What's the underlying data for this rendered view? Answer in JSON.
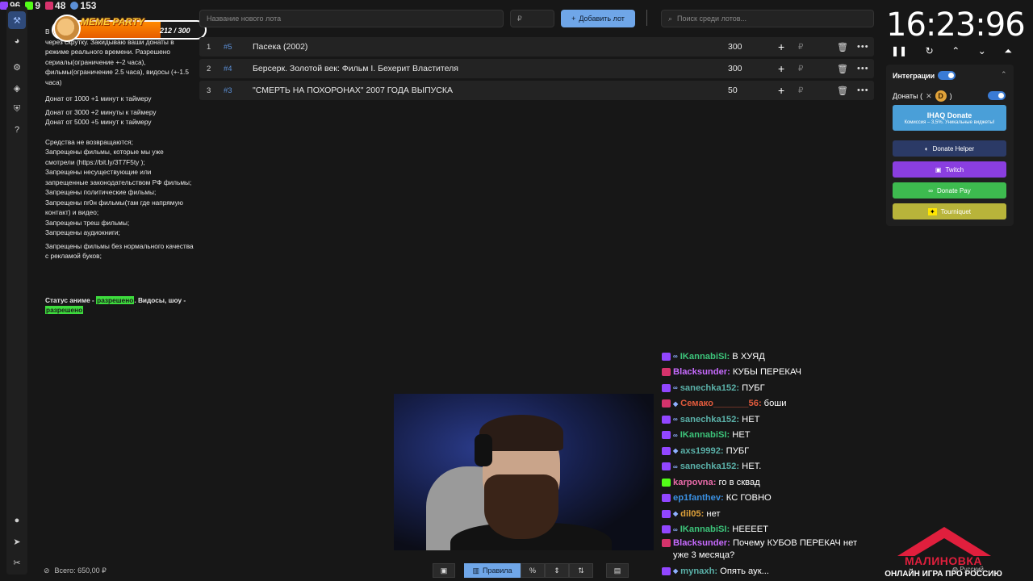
{
  "stats": [
    {
      "icon": "twitch-icon",
      "value": "96",
      "color": "#9146ff"
    },
    {
      "icon": "kick-icon",
      "value": "9",
      "color": "#53fc18"
    },
    {
      "icon": "live-icon",
      "value": "48",
      "color": "#d6336c"
    },
    {
      "icon": "user-icon",
      "value": "153",
      "color": "#5b8fd6"
    }
  ],
  "meme_party": {
    "title": "MEME PARTY",
    "count": "212 / 300",
    "progress": 0.707
  },
  "rules": {
    "intro_prefix": "В",
    "intro": "через скрутку. Закидываю ваши донаты в режиме реального времени. Разрешено сериалы(ограничение +-2 часа), фильмы(ограничение 2.5 часа), видосы (+-1.5 часа)",
    "timer": [
      "Донат от 1000 +1 минут к таймеру",
      "Донат от 3000 +2 минуты к таймеру",
      "Донат от 5000 +5 минут к таймеру"
    ],
    "bans": [
      "Средства не возвращаются;",
      "Запрещены фильмы, которые мы уже смотрели (https://bit.ly/3T7F5ty );",
      "Запрещены несуществующие или запрещенные законодательством РФ фильмы;",
      "Запрещены политические фильмы;",
      "Запрещены пr0н фильмы(там где напрямую контакт) и видео;",
      "Запрещены треш фильмы;",
      "Запрещены аудиокниги;"
    ],
    "quality": "Запрещены фильмы без нормального качества с рекламой буков;",
    "status_a": "Статус аниме - ",
    "status_a_hl": "разрешено",
    "status_b": ". Видосы, шоу - ",
    "status_b_hl": "разрешено"
  },
  "total": {
    "label": "Всего: 650,00 ₽"
  },
  "topbar": {
    "lot_placeholder": "Название нового лота",
    "price_placeholder": "₽",
    "add_label": "Добавить лот",
    "search_placeholder": "Поиск среди лотов..."
  },
  "lots": [
    {
      "num": "1",
      "id": "#5",
      "name": "Пасека (2002)",
      "amount": "300"
    },
    {
      "num": "2",
      "id": "#4",
      "name": "Берсерк. Золотой век: Фильм I. Бехерит Властителя",
      "amount": "300"
    },
    {
      "num": "3",
      "id": "#3",
      "name": " \"СМЕРТЬ НА ПОХОРОНАХ\" 2007 ГОДА ВЫПУСКА",
      "amount": "50"
    }
  ],
  "lot_currency": "₽",
  "timer": {
    "display": "16:23:96"
  },
  "integrations": {
    "title": "Интеграции",
    "donations_label": "Донаты (",
    "donations_close": ")",
    "ihaq_title": "IHAQ Donate",
    "ihaq_sub": "Комиссия – 3,5%. Уникальные виджеты!",
    "buttons": [
      {
        "label": "Donate Helper",
        "color": "#2b3a66"
      },
      {
        "label": "Twitch",
        "color": "#8a3ee0"
      },
      {
        "label": "Donate Pay",
        "color": "#3dbb4f"
      },
      {
        "label": "Tourniquet",
        "color": "#b8b43a"
      }
    ]
  },
  "chat": [
    {
      "badge": "twitch",
      "sub": "∞",
      "user": "IKannabiSI:",
      "color": "#3cc47a",
      "text": "В ХУЯД"
    },
    {
      "badge": "live",
      "sub": "",
      "user": "Blacksunder:",
      "color": "#c86bff",
      "text": "КУБЫ ПЕРЕКАЧ"
    },
    {
      "badge": "twitch",
      "sub": "∞",
      "user": "sanechka152:",
      "color": "#5ab0a8",
      "text": "ПУБГ"
    },
    {
      "badge": "live",
      "sub": "◆",
      "user": "Семако_______56:",
      "color": "#e05a3c",
      "text": "боши"
    },
    {
      "badge": "twitch",
      "sub": "∞",
      "user": "sanechka152:",
      "color": "#5ab0a8",
      "text": "НЕТ"
    },
    {
      "badge": "twitch",
      "sub": "∞",
      "user": "IKannabiSI:",
      "color": "#3cc47a",
      "text": "НЕТ"
    },
    {
      "badge": "twitch",
      "sub": "◆",
      "user": "axs19992:",
      "color": "#5ab0a8",
      "text": "ПУБГ"
    },
    {
      "badge": "twitch",
      "sub": "∞",
      "user": "sanechka152:",
      "color": "#5ab0a8",
      "text": "НЕТ."
    },
    {
      "badge": "kick",
      "sub": "",
      "user": "karpovna:",
      "color": "#e86aa8",
      "text": "го в сквад"
    },
    {
      "badge": "twitch",
      "sub": "",
      "user": "ep1fanthev:",
      "color": "#3a8fe0",
      "text": "КС ГОВНО"
    },
    {
      "badge": "twitch",
      "sub": "◆",
      "user": "dil05:",
      "color": "#e0a23a",
      "text": "нет"
    },
    {
      "badge": "twitch",
      "sub": "∞",
      "user": "IKannabiSI:",
      "color": "#3cc47a",
      "text": "НЕЕЕЕТ"
    },
    {
      "badge": "live",
      "sub": "",
      "user": "Blacksunder:",
      "color": "#c86bff",
      "text": "Почему КУБОВ ПЕРЕКАЧ нет уже 3 месяца?"
    },
    {
      "badge": "twitch",
      "sub": "◆",
      "user": "mynaxh:",
      "color": "#5ab0a8",
      "text": "Опять аук..."
    }
  ],
  "toolbar": {
    "rules_label": "Правила"
  },
  "logo": {
    "name": "МАЛИНОВКА",
    "tagline": "ОНЛАЙН ИГРА ПРО РОССИЮ"
  },
  "language": {
    "label": "Русский"
  }
}
